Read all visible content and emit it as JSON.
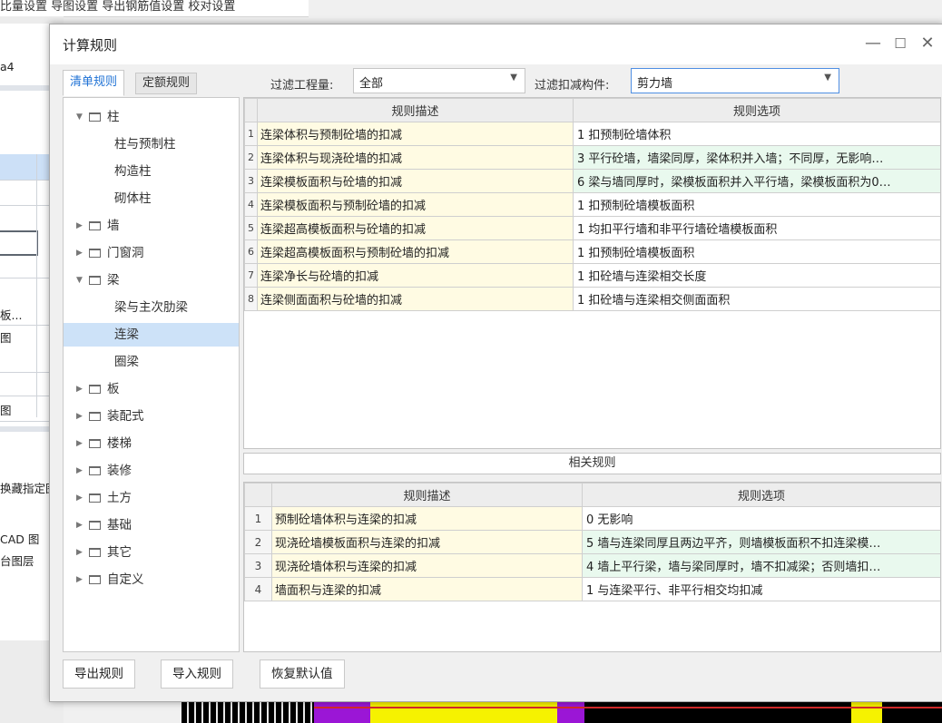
{
  "background": {
    "top_menu_text": "比量设置  导图设置  导出钢筋值设置  校对设置",
    "left_texts": [
      "a4",
      "板...",
      "图",
      "图",
      "换藏指定图",
      "CAD 图",
      "台图层"
    ]
  },
  "dialog": {
    "title": "计算规则",
    "window_buttons": {
      "minimize": "—",
      "maximize": "☐",
      "close": "✕"
    },
    "tabs": [
      "清单规则",
      "定额规则"
    ],
    "filter": {
      "quantity_label": "过滤工程量:",
      "quantity_value": "全部",
      "component_label": "过滤扣减构件:",
      "component_value": "剪力墙"
    },
    "tree": [
      {
        "label": "柱",
        "folder": true,
        "expanded": true
      },
      {
        "label": "柱与预制柱",
        "folder": false
      },
      {
        "label": "构造柱",
        "folder": false
      },
      {
        "label": "砌体柱",
        "folder": false
      },
      {
        "label": "墙",
        "folder": true,
        "expanded": false
      },
      {
        "label": "门窗洞",
        "folder": true,
        "expanded": false
      },
      {
        "label": "梁",
        "folder": true,
        "expanded": true
      },
      {
        "label": "梁与主次肋梁",
        "folder": false
      },
      {
        "label": "连梁",
        "folder": false,
        "selected": true
      },
      {
        "label": "圈梁",
        "folder": false
      },
      {
        "label": "板",
        "folder": true,
        "expanded": false
      },
      {
        "label": "装配式",
        "folder": true,
        "expanded": false
      },
      {
        "label": "楼梯",
        "folder": true,
        "expanded": false
      },
      {
        "label": "装修",
        "folder": true,
        "expanded": false
      },
      {
        "label": "土方",
        "folder": true,
        "expanded": false
      },
      {
        "label": "基础",
        "folder": true,
        "expanded": false
      },
      {
        "label": "其它",
        "folder": true,
        "expanded": false
      },
      {
        "label": "自定义",
        "folder": true,
        "expanded": false
      }
    ],
    "rules_table": {
      "headers": [
        "规则描述",
        "规则选项"
      ],
      "rows": [
        {
          "num": "1",
          "desc": "连梁体积与预制砼墙的扣减",
          "option": "1 扣预制砼墙体积",
          "green": false
        },
        {
          "num": "2",
          "desc": "连梁体积与现浇砼墙的扣减",
          "option": "3 平行砼墙，墙梁同厚，梁体积并入墙；不同厚，无影响…",
          "green": true
        },
        {
          "num": "3",
          "desc": "连梁模板面积与砼墙的扣减",
          "option": "6 梁与墙同厚时，梁模板面积并入平行墙，梁模板面积为0…",
          "green": true
        },
        {
          "num": "4",
          "desc": "连梁模板面积与预制砼墙的扣减",
          "option": "1  扣预制砼墙模板面积",
          "green": false
        },
        {
          "num": "5",
          "desc": "连梁超高模板面积与砼墙的扣减",
          "option": "1 均扣平行墙和非平行墙砼墙模板面积",
          "green": false
        },
        {
          "num": "6",
          "desc": "连梁超高模板面积与预制砼墙的扣减",
          "option": "1 扣预制砼墙模板面积",
          "green": false
        },
        {
          "num": "7",
          "desc": "连梁净长与砼墙的扣减",
          "option": "1 扣砼墙与连梁相交长度",
          "green": false
        },
        {
          "num": "8",
          "desc": "连梁侧面面积与砼墙的扣减",
          "option": "1 扣砼墙与连梁相交侧面面积",
          "green": false
        }
      ]
    },
    "related_title": "相关规则",
    "related_table": {
      "headers": [
        "规则描述",
        "规则选项"
      ],
      "rows": [
        {
          "num": "1",
          "desc": "预制砼墙体积与连梁的扣减",
          "option": "0  无影响",
          "green": false
        },
        {
          "num": "2",
          "desc": "现浇砼墙模板面积与连梁的扣减",
          "option": "5 墙与连梁同厚且两边平齐，则墙模板面积不扣连梁模…",
          "green": true
        },
        {
          "num": "3",
          "desc": "现浇砼墙体积与连梁的扣减",
          "option": "4  墙上平行梁，墙与梁同厚时，墙不扣减梁；否则墙扣…",
          "green": true
        },
        {
          "num": "4",
          "desc": "墙面积与连梁的扣减",
          "option": "1 与连梁平行、非平行相交均扣减",
          "green": false
        }
      ]
    },
    "buttons": [
      "导出规则",
      "导入规则",
      "恢复默认值"
    ]
  },
  "colors": {
    "accent": "#1f72d5",
    "selection": "#cde2f8",
    "desc_bg": "#fffbe3",
    "option_changed_bg": "#e9f9ee"
  },
  "icons": {
    "tree_folder": "folder-icon",
    "tree_toggle": "caret-icon",
    "combo_arrow": "chevron-down-icon"
  }
}
